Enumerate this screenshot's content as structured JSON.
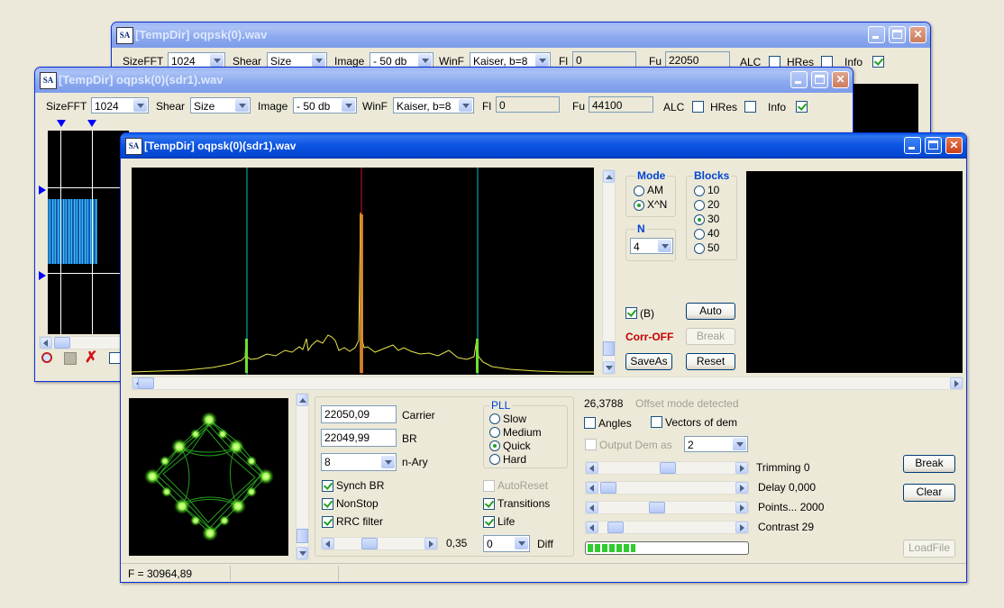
{
  "windows": {
    "back": {
      "title": "[TempDir] oqpsk(0).wav",
      "sizefft_label": "SizeFFT",
      "sizefft_value": "1024",
      "shear_label": "Shear",
      "shear_value": "Size",
      "image_label": "Image",
      "image_value": "- 50 db",
      "winf_label": "WinF",
      "winf_value": "Kaiser, b=8",
      "fl_label": "Fl",
      "fl_value": "0",
      "fu_label": "Fu",
      "fu_value": "22050",
      "alc_label": "ALC",
      "hres_label": "HRes",
      "info_label": "Info"
    },
    "middle": {
      "title": "[TempDir] oqpsk(0)(sdr1).wav",
      "sizefft_label": "SizeFFT",
      "sizefft_value": "1024",
      "shear_label": "Shear",
      "shear_value": "Size",
      "image_label": "Image",
      "image_value": "- 50 db",
      "winf_label": "WinF",
      "winf_value": "Kaiser, b=8",
      "fl_label": "Fl",
      "fl_value": "0",
      "fu_label": "Fu",
      "fu_value": "44100",
      "alc_label": "ALC",
      "hres_label": "HRes",
      "info_label": "Info"
    },
    "front": {
      "title": "[TempDir] oqpsk(0)(sdr1).wav",
      "mode": {
        "title": "Mode",
        "options": [
          "AM",
          "X^N"
        ],
        "selected": "X^N"
      },
      "blocks": {
        "title": "Blocks",
        "options": [
          "10",
          "20",
          "30",
          "40",
          "50"
        ],
        "selected": "30"
      },
      "n": {
        "title": "N",
        "value": "4"
      },
      "b_label": "(B)",
      "corr_off": "Corr-OFF",
      "buttons": {
        "auto": "Auto",
        "break": "Break",
        "saveas": "SaveAs",
        "reset": "Reset",
        "break2": "Break",
        "clear": "Clear",
        "loadfile": "LoadFile"
      },
      "carrier_value": "22050,09",
      "carrier_label": "Carrier",
      "br_value": "22049,99",
      "br_label": "BR",
      "nary_value": "8",
      "nary_label": "n-Ary",
      "pll": {
        "title": "PLL",
        "options": [
          "Slow",
          "Medium",
          "Quick",
          "Hard"
        ],
        "selected": "Quick"
      },
      "synch_br": "Synch BR",
      "nonstop": "NonStop",
      "rrc_filter": "RRC filter",
      "autoreset": "AutoReset",
      "transitions": "Transitions",
      "life": "Life",
      "slider_value": "0,35",
      "diff_value": "0",
      "diff_label": "Diff",
      "offset_value": "26,3788",
      "offset_text": "Offset mode detected",
      "angles": "Angles",
      "vectors": "Vectors of dem",
      "output_dem": "Output Dem as",
      "output_dem_value": "2",
      "trimming": "Trimming 0",
      "delay": "Delay  0,000",
      "points": "Points... 2000",
      "contrast": "Contrast 29",
      "status": "F = 30964,89",
      "progress": 0.3
    }
  }
}
